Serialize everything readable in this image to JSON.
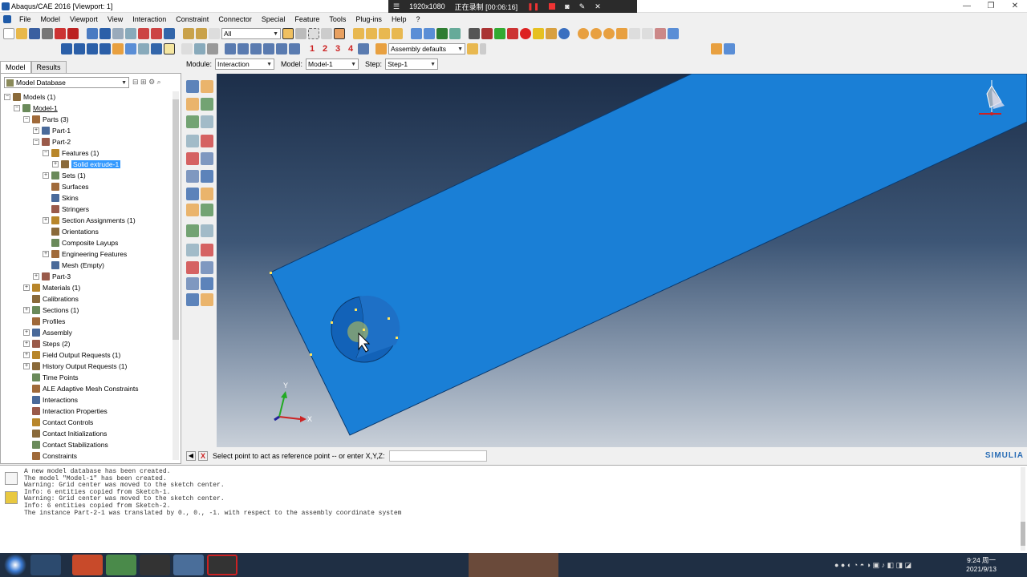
{
  "window": {
    "title": "Abaqus/CAE 2016 [Viewport: 1]",
    "controls": [
      "—",
      "❐",
      "✕"
    ]
  },
  "recorder": {
    "resolution": "1920x1080",
    "status": "正在录制 [00:06:16]"
  },
  "menu": [
    "File",
    "Model",
    "Viewport",
    "View",
    "Interaction",
    "Constraint",
    "Connector",
    "Special",
    "Feature",
    "Tools",
    "Plug-ins",
    "Help",
    "?"
  ],
  "toolbar": {
    "filter": "All",
    "render_style": "Assembly defaults",
    "num_labels": [
      "1",
      "2",
      "3",
      "4"
    ]
  },
  "context": {
    "module_label": "Module:",
    "module": "Interaction",
    "model_label": "Model:",
    "model": "Model-1",
    "step_label": "Step:",
    "step": "Step-1"
  },
  "tabs": [
    "Model",
    "Results"
  ],
  "tree_header": "Model Database",
  "tree": [
    {
      "label": "Models (1)",
      "level": 0,
      "exp": "−"
    },
    {
      "label": "Model-1",
      "level": 1,
      "exp": "−",
      "underline": true
    },
    {
      "label": "Parts (3)",
      "level": 2,
      "exp": "−"
    },
    {
      "label": "Part-1",
      "level": 3,
      "exp": "+"
    },
    {
      "label": "Part-2",
      "level": 3,
      "exp": "−"
    },
    {
      "label": "Features (1)",
      "level": 4,
      "exp": "−"
    },
    {
      "label": "Solid extrude-1",
      "level": 5,
      "exp": "+",
      "selected": true
    },
    {
      "label": "Sets (1)",
      "level": 4,
      "exp": "+"
    },
    {
      "label": "Surfaces",
      "level": 4,
      "exp": ""
    },
    {
      "label": "Skins",
      "level": 4,
      "exp": ""
    },
    {
      "label": "Stringers",
      "level": 4,
      "exp": ""
    },
    {
      "label": "Section Assignments (1)",
      "level": 4,
      "exp": "+"
    },
    {
      "label": "Orientations",
      "level": 4,
      "exp": ""
    },
    {
      "label": "Composite Layups",
      "level": 4,
      "exp": ""
    },
    {
      "label": "Engineering Features",
      "level": 4,
      "exp": "+"
    },
    {
      "label": "Mesh (Empty)",
      "level": 4,
      "exp": ""
    },
    {
      "label": "Part-3",
      "level": 3,
      "exp": "+"
    },
    {
      "label": "Materials (1)",
      "level": 2,
      "exp": "+"
    },
    {
      "label": "Calibrations",
      "level": 2,
      "exp": ""
    },
    {
      "label": "Sections (1)",
      "level": 2,
      "exp": "+"
    },
    {
      "label": "Profiles",
      "level": 2,
      "exp": ""
    },
    {
      "label": "Assembly",
      "level": 2,
      "exp": "+"
    },
    {
      "label": "Steps (2)",
      "level": 2,
      "exp": "+"
    },
    {
      "label": "Field Output Requests (1)",
      "level": 2,
      "exp": "+"
    },
    {
      "label": "History Output Requests (1)",
      "level": 2,
      "exp": "+"
    },
    {
      "label": "Time Points",
      "level": 2,
      "exp": ""
    },
    {
      "label": "ALE Adaptive Mesh Constraints",
      "level": 2,
      "exp": ""
    },
    {
      "label": "Interactions",
      "level": 2,
      "exp": ""
    },
    {
      "label": "Interaction Properties",
      "level": 2,
      "exp": ""
    },
    {
      "label": "Contact Controls",
      "level": 2,
      "exp": ""
    },
    {
      "label": "Contact Initializations",
      "level": 2,
      "exp": ""
    },
    {
      "label": "Contact Stabilizations",
      "level": 2,
      "exp": ""
    },
    {
      "label": "Constraints",
      "level": 2,
      "exp": ""
    }
  ],
  "prompt": {
    "text": "Select point to act as reference point -- or enter X,Y,Z:",
    "value": ""
  },
  "brand": "SIMULIA",
  "triad": {
    "x": "X",
    "y": "Y"
  },
  "messages": "A new model database has been created.\nThe model \"Model-1\" has been created.\nWarning: Grid center was moved to the sketch center.\nInfo: 6 entities copied from Sketch-1.\nWarning: Grid center was moved to the sketch center.\nInfo: 6 entities copied from Sketch-2.\nThe instance Part-2-1 was translated by 0., 0., -1. with respect to the assembly coordinate system",
  "clock": {
    "time": "9:24 周一",
    "date": "2021/9/13"
  },
  "colors": {
    "part_blue": "#1a7fd6",
    "selected": "#3399ff",
    "taskbar": "#1f2f44"
  }
}
